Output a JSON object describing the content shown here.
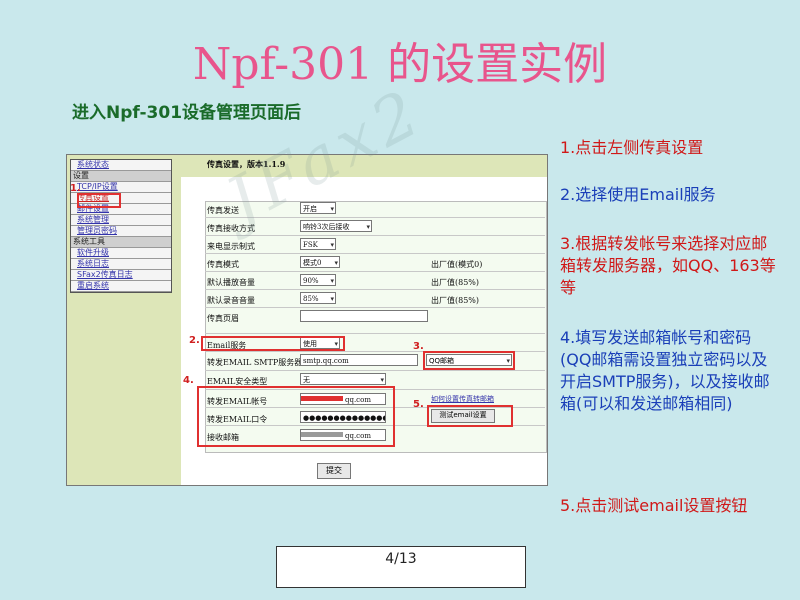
{
  "slide": {
    "title": "Npf-301 的设置实例",
    "subtitle": "进入Npf-301设备管理页面后",
    "page_indicator": "4/13"
  },
  "screenshot": {
    "menu": [
      {
        "label": "系统状态",
        "type": "link"
      },
      {
        "label": "设置",
        "type": "section"
      },
      {
        "label": "TCP/IP设置",
        "type": "link"
      },
      {
        "label": "传真设置",
        "type": "link",
        "highlight": true
      },
      {
        "label": "邮件设置",
        "type": "link"
      },
      {
        "label": "系统管理",
        "type": "link"
      },
      {
        "label": "管理员密码",
        "type": "link"
      },
      {
        "label": "系统工具",
        "type": "section"
      },
      {
        "label": "软件升级",
        "type": "link"
      },
      {
        "label": "系统日志",
        "type": "link"
      },
      {
        "label": "SFax2传真日志",
        "type": "link"
      },
      {
        "label": "重启系统",
        "type": "link"
      }
    ],
    "section_title": "传真设置，版本1.1.9",
    "fields": {
      "fax_send": {
        "label": "传真发送",
        "value": "开启"
      },
      "fax_receive": {
        "label": "传真接收方式",
        "value": "响铃3次后接收"
      },
      "caller_id": {
        "label": "来电显示制式",
        "value": "FSK"
      },
      "fax_mode": {
        "label": "传真模式",
        "value": "模式0",
        "note": "出厂值(模式0)"
      },
      "default_play_volume": {
        "label": "默认播放音量",
        "value": "90%",
        "note": "出厂值(85%)"
      },
      "default_record_volume": {
        "label": "默认录音音量",
        "value": "85%",
        "note": "出厂值(85%)"
      },
      "fax_header": {
        "label": "传真页眉",
        "value": ""
      },
      "email_service": {
        "label": "Email服务",
        "value": "使用"
      },
      "smtp_server": {
        "label": "转发EMAIL SMTP服务器",
        "value": "smtp.qq.com"
      },
      "email_security": {
        "label": "EMAIL安全类型",
        "value": "无"
      },
      "email_account": {
        "label": "转发EMAIL帐号",
        "value": "qq.com"
      },
      "email_password": {
        "label": "转发EMAIL口令",
        "value": "●●●●●●●●●●●●●●●●"
      },
      "receive_mailbox": {
        "label": "接收邮箱",
        "value": "qq.com"
      }
    },
    "qq_select": "QQ邮箱",
    "qq_link": "如何设置传真转邮箱",
    "test_button": "测试email设置",
    "submit_button": "提交",
    "step_markers": [
      "1.",
      "2.",
      "3.",
      "4.",
      "5."
    ]
  },
  "instructions": [
    {
      "text": "1.点击左侧传真设置",
      "color": "red"
    },
    {
      "text": "2.选择使用Email服务",
      "color": "blue"
    },
    {
      "text": "3.根据转发帐号来选择对应邮箱转发服务器，如QQ、163等等",
      "color": "red"
    },
    {
      "text": "4.填写发送邮箱帐号和密码(QQ邮箱需设置独立密码以及开启SMTP服务)，以及接收邮箱(可以和发送邮箱相同)",
      "color": "blue"
    },
    {
      "text": "5.点击测试email设置按钮",
      "color": "red"
    }
  ],
  "watermark": "JFax2",
  "colors": {
    "accent_red": "#e03030",
    "title_pink": "#e8558c",
    "subtitle_green": "#1a6b2a",
    "instr_blue": "#1a3fb8",
    "bg": "#c9e8ec"
  }
}
